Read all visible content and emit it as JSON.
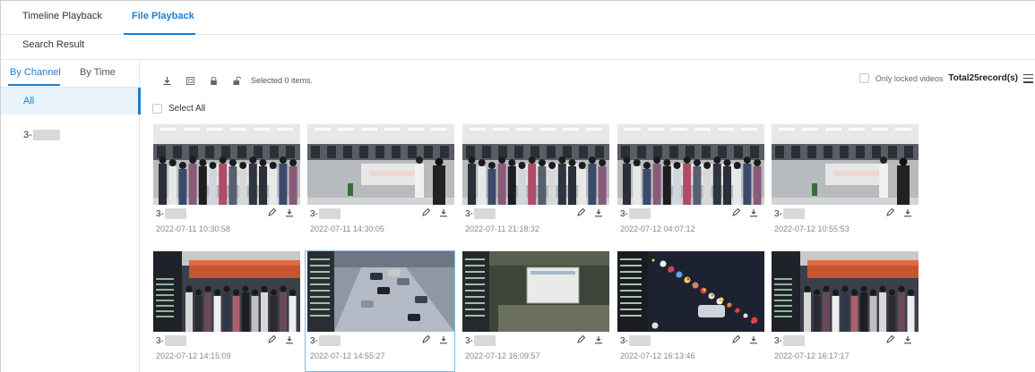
{
  "tabs": {
    "timeline": "Timeline Playback",
    "file": "File Playback"
  },
  "search_result": "Search Result",
  "left": {
    "by_channel": "By Channel",
    "by_time": "By Time",
    "all": "All",
    "channel_prefix": "3-"
  },
  "toolbar": {
    "icons": [
      "download-icon",
      "clip-icon",
      "lock-icon",
      "unlock-icon"
    ],
    "selected_text": "Selected 0 items.",
    "only_locked": "Only locked videos",
    "total": "Total25record(s)"
  },
  "select_all": "Select All",
  "colors": {
    "accent": "#1a7fd0",
    "selected_bg": "#e8f3fc"
  },
  "records": [
    {
      "channel": "3-",
      "time": "2022-07-11 10:30:58",
      "scene": "office-crowd"
    },
    {
      "channel": "3-",
      "time": "2022-07-11 14:30:05",
      "scene": "office-empty"
    },
    {
      "channel": "3-",
      "time": "2022-07-11 21:18:32",
      "scene": "office-crowd"
    },
    {
      "channel": "3-",
      "time": "2022-07-12 04:07:12",
      "scene": "office-crowd"
    },
    {
      "channel": "3-",
      "time": "2022-07-12 10:55:53",
      "scene": "office-empty"
    },
    {
      "channel": "3-",
      "time": "2022-07-12 14:15:09",
      "scene": "indoor-crowd"
    },
    {
      "channel": "3-",
      "time": "2022-07-12 14:55:27",
      "scene": "road",
      "selected": true
    },
    {
      "channel": "3-",
      "time": "2022-07-12 16:09:57",
      "scene": "monitor"
    },
    {
      "channel": "3-",
      "time": "2022-07-12 16:13:46",
      "scene": "night-street"
    },
    {
      "channel": "3-",
      "time": "2022-07-12 16:17:17",
      "scene": "indoor-crowd"
    }
  ]
}
